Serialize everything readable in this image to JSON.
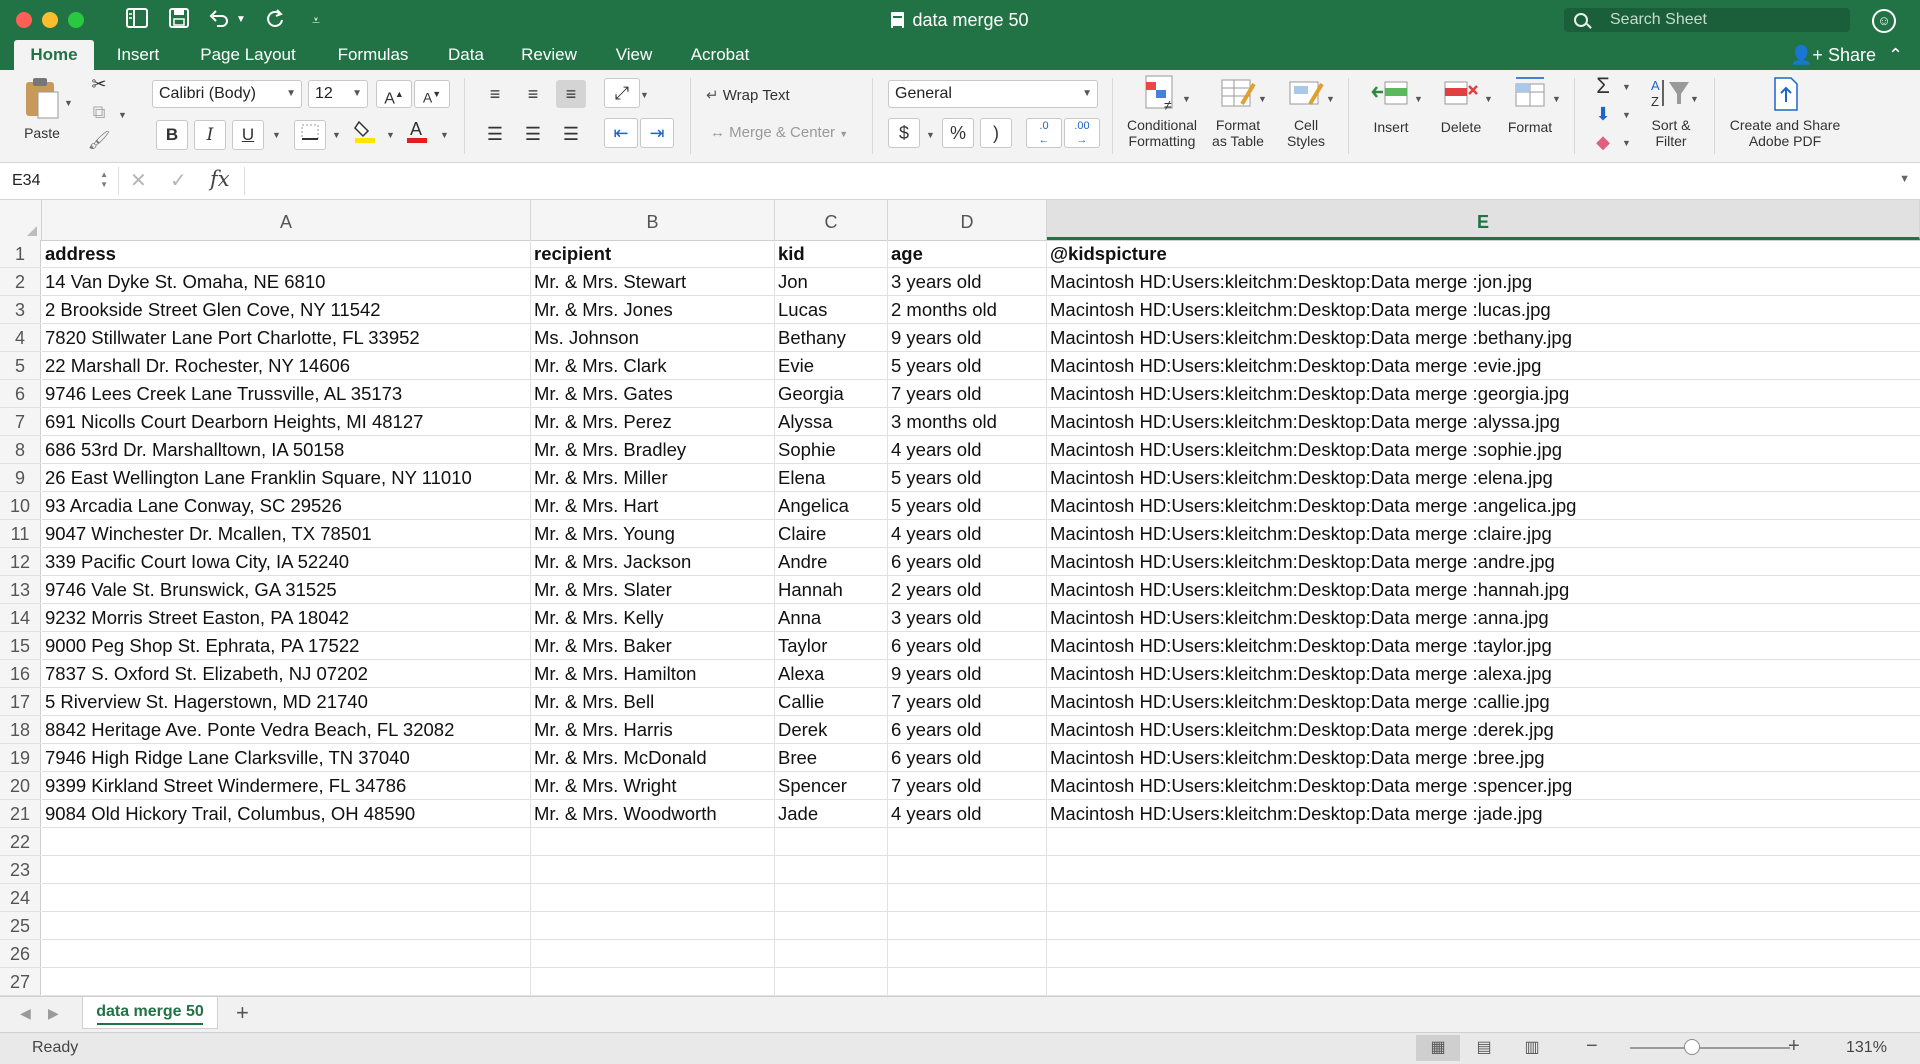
{
  "window": {
    "title": "data merge 50",
    "search_placeholder": "Search Sheet"
  },
  "ribbon_tabs": [
    {
      "label": "Home",
      "active": true
    },
    {
      "label": "Insert"
    },
    {
      "label": "Page Layout"
    },
    {
      "label": "Formulas"
    },
    {
      "label": "Data"
    },
    {
      "label": "Review"
    },
    {
      "label": "View"
    },
    {
      "label": "Acrobat"
    }
  ],
  "share_label": "Share",
  "ribbon": {
    "paste": "Paste",
    "font_name": "Calibri (Body)",
    "font_size": "12",
    "wrap_text": "Wrap Text",
    "merge_center": "Merge & Center",
    "number_format": "General",
    "currency": "$",
    "percent": "%",
    "comma": ")",
    "increase_decimal": ".0",
    "decrease_decimal": ".00",
    "conditional_formatting": [
      "Conditional",
      "Formatting"
    ],
    "format_as_table": [
      "Format",
      "as Table"
    ],
    "cell_styles": [
      "Cell",
      "Styles"
    ],
    "insert": "Insert",
    "delete": "Delete",
    "format": "Format",
    "sort_filter": [
      "Sort &",
      "Filter"
    ],
    "adobe_pdf": [
      "Create and Share",
      "Adobe PDF"
    ],
    "bold": "B",
    "italic": "I",
    "underline": "U"
  },
  "formula_bar": {
    "name_box": "E34",
    "fx": "fx",
    "formula": ""
  },
  "sheet": {
    "columns": [
      "A",
      "B",
      "C",
      "D",
      "E"
    ],
    "selected_column": "E",
    "row_numbers": [
      "1",
      "2",
      "3",
      "4",
      "5",
      "6",
      "7",
      "8",
      "9",
      "10",
      "11",
      "12",
      "13",
      "14",
      "15",
      "16",
      "17",
      "18",
      "19",
      "20",
      "21",
      "22",
      "23",
      "24",
      "25",
      "26",
      "27"
    ],
    "rows": [
      [
        "address",
        "recipient",
        "kid",
        "age",
        "@kidspicture"
      ],
      [
        "14 Van Dyke St. Omaha, NE 6810",
        "Mr. & Mrs. Stewart",
        "Jon",
        "3 years old",
        "Macintosh HD:Users:kleitchm:Desktop:Data merge :jon.jpg"
      ],
      [
        "2 Brookside Street Glen Cove, NY 11542",
        "Mr. & Mrs. Jones",
        "Lucas",
        "2 months old",
        "Macintosh HD:Users:kleitchm:Desktop:Data merge :lucas.jpg"
      ],
      [
        "7820 Stillwater Lane Port Charlotte, FL 33952",
        "Ms. Johnson",
        "Bethany",
        "9 years old",
        "Macintosh HD:Users:kleitchm:Desktop:Data merge :bethany.jpg"
      ],
      [
        "22 Marshall Dr. Rochester, NY 14606",
        "Mr. & Mrs. Clark",
        "Evie",
        "5 years old",
        "Macintosh HD:Users:kleitchm:Desktop:Data merge :evie.jpg"
      ],
      [
        "9746 Lees Creek Lane Trussville, AL 35173",
        "Mr. & Mrs. Gates",
        "Georgia",
        "7 years old",
        "Macintosh HD:Users:kleitchm:Desktop:Data merge :georgia.jpg"
      ],
      [
        "691 Nicolls Court Dearborn Heights, MI 48127",
        "Mr. & Mrs. Perez",
        "Alyssa",
        "3 months old",
        "Macintosh HD:Users:kleitchm:Desktop:Data merge :alyssa.jpg"
      ],
      [
        "686 53rd Dr. Marshalltown, IA 50158",
        "Mr. & Mrs. Bradley",
        "Sophie",
        "4 years old",
        "Macintosh HD:Users:kleitchm:Desktop:Data merge :sophie.jpg"
      ],
      [
        "26 East Wellington Lane Franklin Square, NY 11010",
        "Mr. & Mrs. Miller",
        "Elena",
        "5 years old",
        "Macintosh HD:Users:kleitchm:Desktop:Data merge :elena.jpg"
      ],
      [
        "93 Arcadia Lane Conway, SC 29526",
        "Mr. & Mrs. Hart",
        "Angelica",
        "5 years old",
        "Macintosh HD:Users:kleitchm:Desktop:Data merge :angelica.jpg"
      ],
      [
        "9047 Winchester Dr. Mcallen, TX 78501",
        "Mr. & Mrs. Young",
        "Claire",
        "4 years old",
        "Macintosh HD:Users:kleitchm:Desktop:Data merge :claire.jpg"
      ],
      [
        "339 Pacific Court Iowa City, IA 52240",
        "Mr. & Mrs. Jackson",
        "Andre",
        "6 years old",
        "Macintosh HD:Users:kleitchm:Desktop:Data merge :andre.jpg"
      ],
      [
        "9746 Vale St. Brunswick, GA 31525",
        "Mr. & Mrs. Slater",
        "Hannah",
        "2 years old",
        "Macintosh HD:Users:kleitchm:Desktop:Data merge :hannah.jpg"
      ],
      [
        "9232 Morris Street Easton, PA 18042",
        "Mr. & Mrs. Kelly",
        "Anna",
        "3 years old",
        "Macintosh HD:Users:kleitchm:Desktop:Data merge :anna.jpg"
      ],
      [
        "9000 Peg Shop St. Ephrata, PA 17522",
        "Mr. & Mrs. Baker",
        "Taylor",
        "6 years old",
        "Macintosh HD:Users:kleitchm:Desktop:Data merge :taylor.jpg"
      ],
      [
        "7837 S. Oxford St. Elizabeth, NJ 07202",
        "Mr. & Mrs. Hamilton",
        "Alexa",
        "9 years old",
        "Macintosh HD:Users:kleitchm:Desktop:Data merge :alexa.jpg"
      ],
      [
        "5 Riverview St. Hagerstown, MD 21740",
        "Mr. & Mrs. Bell",
        "Callie",
        "7 years old",
        "Macintosh HD:Users:kleitchm:Desktop:Data merge :callie.jpg"
      ],
      [
        "8842 Heritage Ave. Ponte Vedra Beach, FL 32082",
        "Mr. & Mrs. Harris",
        "Derek",
        "6 years old",
        "Macintosh HD:Users:kleitchm:Desktop:Data merge :derek.jpg"
      ],
      [
        "7946 High Ridge Lane Clarksville, TN 37040",
        "Mr. & Mrs. McDonald",
        "Bree",
        "6 years old",
        "Macintosh HD:Users:kleitchm:Desktop:Data merge :bree.jpg"
      ],
      [
        "9399 Kirkland Street Windermere, FL 34786",
        "Mr. & Mrs. Wright",
        "Spencer",
        "7 years old",
        "Macintosh HD:Users:kleitchm:Desktop:Data merge :spencer.jpg"
      ],
      [
        "9084 Old Hickory Trail, Columbus, OH 48590",
        "Mr. & Mrs. Woodworth",
        "Jade",
        "4 years old",
        "Macintosh HD:Users:kleitchm:Desktop:Data merge :jade.jpg"
      ],
      [
        "",
        "",
        "",
        "",
        ""
      ],
      [
        "",
        "",
        "",
        "",
        ""
      ],
      [
        "",
        "",
        "",
        "",
        ""
      ],
      [
        "",
        "",
        "",
        "",
        ""
      ],
      [
        "",
        "",
        "",
        "",
        ""
      ],
      [
        "",
        "",
        "",
        "",
        ""
      ]
    ]
  },
  "sheet_tabs": [
    {
      "label": "data merge 50",
      "active": true
    }
  ],
  "status": {
    "text": "Ready",
    "zoom": "131%",
    "zoom_fraction": 0.39
  },
  "colors": {
    "accent": "#217346",
    "font_color_bar": "#e02020",
    "highlight_bar": "#ffe600"
  }
}
